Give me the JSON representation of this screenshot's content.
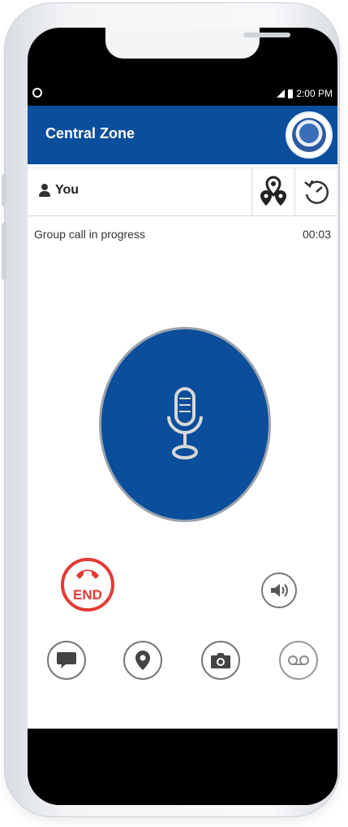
{
  "status_bar": {
    "time": "2:00 PM"
  },
  "header": {
    "title": "Central Zone",
    "logo_icon": "agency-seal-logo"
  },
  "user_row": {
    "label": "You",
    "icons": [
      "map-pins-icon",
      "refresh-icon"
    ]
  },
  "call": {
    "status": "Group call in progress",
    "timer": "00:03"
  },
  "controls": {
    "ptt_icon": "microphone-icon",
    "end_label": "END",
    "speaker_icon": "speaker-volume-icon",
    "bottom_icons": [
      "chat-icon",
      "location-icon",
      "camera-icon",
      "voicemail-icon"
    ]
  },
  "colors": {
    "brand_blue": "#0b4e9b",
    "end_red": "#e53935"
  }
}
